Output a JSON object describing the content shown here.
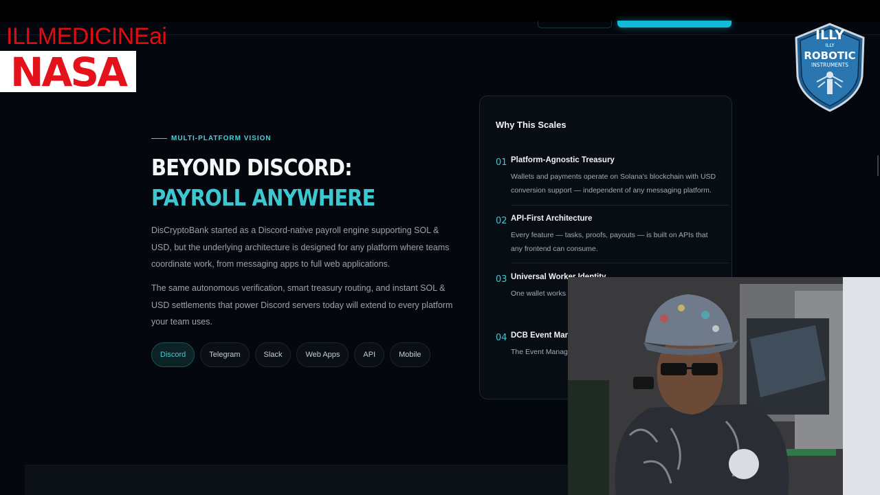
{
  "overlay": {
    "brand_text": "ILLMEDICINEai",
    "nasa_logo": "NASA",
    "badge": {
      "line1": "ILLY",
      "line2": "ILLY",
      "line3": "ROBOTIC",
      "line4": "INSTRUMENTS"
    }
  },
  "hero": {
    "eyebrow": "MULTI-PLATFORM VISION",
    "headline_line1": "BEYOND DISCORD:",
    "headline_line2": "PAYROLL ANYWHERE",
    "paragraph1": "DisCryptoBank started as a Discord-native payroll engine supporting SOL & USD, but the underlying architecture is designed for any platform where teams coordinate work, from messaging apps to full web applications.",
    "paragraph2": "The same autonomous verification, smart treasury routing, and instant SOL & USD settlements that power Discord servers today will extend to every platform your team uses.",
    "platforms": [
      "Discord",
      "Telegram",
      "Slack",
      "Web Apps",
      "API",
      "Mobile"
    ],
    "active_platform": "Discord"
  },
  "card": {
    "title": "Why This Scales",
    "items": [
      {
        "num": "01",
        "title": "Platform-Agnostic Treasury",
        "desc": "Wallets and payments operate on Solana's blockchain with USD conversion support — independent of any messaging platform."
      },
      {
        "num": "02",
        "title": "API-First Architecture",
        "desc": "Every feature — tasks, proofs, payouts — is built on APIs that any frontend can consume."
      },
      {
        "num": "03",
        "title": "Universal Worker Identity",
        "desc": "One wallet works a need separate acc"
      },
      {
        "num": "04",
        "title": "DCB Event Mana",
        "desc": "The Event Manage standalone web ap"
      }
    ]
  },
  "colors": {
    "accent": "#3ec7d1",
    "background": "#04070d",
    "brand_red": "#e10b12",
    "cta": "#13b9d8"
  },
  "icons": [
    "nasa-logo-icon",
    "illy-robotic-badge-icon",
    "webcam-person-icon"
  ]
}
